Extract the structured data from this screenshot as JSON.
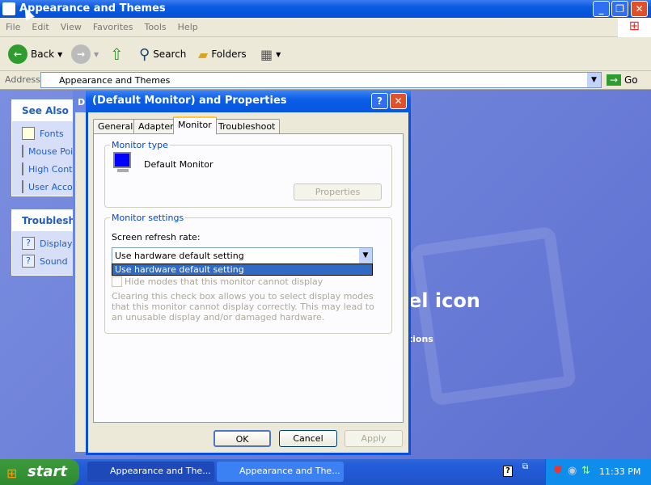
{
  "window": {
    "title": "Appearance and Themes"
  },
  "menu": [
    "File",
    "Edit",
    "View",
    "Favorites",
    "Tools",
    "Help"
  ],
  "toolbar": {
    "back": "Back",
    "search": "Search",
    "folders": "Folders"
  },
  "address": {
    "label": "Address",
    "value": "Appearance and Themes",
    "go": "Go"
  },
  "see_also": {
    "title": "See Also",
    "items": [
      "Fonts",
      "Mouse Pointers",
      "High Contrast",
      "User Account Picture"
    ]
  },
  "troubleshooters": {
    "title": "Troubleshooters",
    "items": [
      "Display",
      "Sound"
    ]
  },
  "background": {
    "heading_fragment": "el icon",
    "options_fragment": "ptions",
    "back_dialog_title": "D"
  },
  "dialog": {
    "title": "(Default Monitor) and  Properties",
    "tabs": [
      "General",
      "Adapter",
      "Monitor",
      "Troubleshoot"
    ],
    "active_tab": "Monitor",
    "monitor_type": {
      "legend": "Monitor type",
      "name": "Default Monitor",
      "properties": "Properties"
    },
    "monitor_settings": {
      "legend": "Monitor settings",
      "refresh_label": "Screen refresh rate:",
      "refresh_value": "Use hardware default setting",
      "dropdown_options": [
        "Use hardware default setting"
      ],
      "hide_modes": "Hide modes that this monitor cannot display",
      "hide_modes_checked": false,
      "note": "Clearing this check box allows you to select display modes that this monitor cannot display correctly. This may lead to an unusable display and/or damaged hardware."
    },
    "ok": "OK",
    "cancel": "Cancel",
    "apply": "Apply"
  },
  "taskbar": {
    "start": "start",
    "tasks": [
      "Appearance and The...",
      "Appearance and The..."
    ],
    "clock": "11:33 PM"
  },
  "colors": {
    "xp_blue": "#0a5ae0",
    "selection": "#316ac5",
    "start_green": "#3c9a3c"
  }
}
